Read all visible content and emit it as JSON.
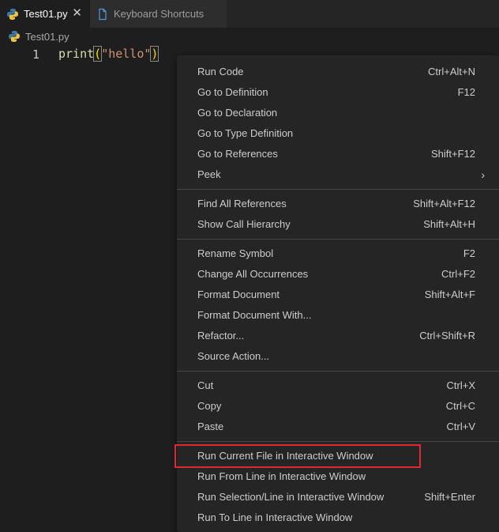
{
  "tabs": [
    {
      "label": "Test01.py",
      "active": true,
      "icon": "python-icon",
      "close": "✕"
    },
    {
      "label": "Keyboard Shortcuts",
      "active": false,
      "icon": "document-icon"
    }
  ],
  "breadcrumb": {
    "file": "Test01.py",
    "icon": "python-icon"
  },
  "editor": {
    "line_number": "1",
    "code": {
      "fn": "print",
      "open": "(",
      "str": "\"hello\"",
      "close": ")"
    }
  },
  "context_menu": {
    "groups": [
      [
        {
          "label": "Run Code",
          "shortcut": "Ctrl+Alt+N"
        },
        {
          "label": "Go to Definition",
          "shortcut": "F12"
        },
        {
          "label": "Go to Declaration",
          "shortcut": ""
        },
        {
          "label": "Go to Type Definition",
          "shortcut": ""
        },
        {
          "label": "Go to References",
          "shortcut": "Shift+F12"
        },
        {
          "label": "Peek",
          "shortcut": "",
          "submenu": true
        }
      ],
      [
        {
          "label": "Find All References",
          "shortcut": "Shift+Alt+F12"
        },
        {
          "label": "Show Call Hierarchy",
          "shortcut": "Shift+Alt+H"
        }
      ],
      [
        {
          "label": "Rename Symbol",
          "shortcut": "F2"
        },
        {
          "label": "Change All Occurrences",
          "shortcut": "Ctrl+F2"
        },
        {
          "label": "Format Document",
          "shortcut": "Shift+Alt+F"
        },
        {
          "label": "Format Document With...",
          "shortcut": ""
        },
        {
          "label": "Refactor...",
          "shortcut": "Ctrl+Shift+R"
        },
        {
          "label": "Source Action...",
          "shortcut": ""
        }
      ],
      [
        {
          "label": "Cut",
          "shortcut": "Ctrl+X"
        },
        {
          "label": "Copy",
          "shortcut": "Ctrl+C"
        },
        {
          "label": "Paste",
          "shortcut": "Ctrl+V"
        }
      ],
      [
        {
          "label": "Run Current File in Interactive Window",
          "shortcut": "",
          "highlighted": true
        },
        {
          "label": "Run From Line in Interactive Window",
          "shortcut": ""
        },
        {
          "label": "Run Selection/Line in Interactive Window",
          "shortcut": "Shift+Enter"
        },
        {
          "label": "Run To Line in Interactive Window",
          "shortcut": ""
        }
      ]
    ]
  },
  "colors": {
    "background": "#1e1e1e",
    "menu_background": "#252526",
    "highlight_border": "#e0282e",
    "function": "#dcdcaa",
    "string": "#ce9178",
    "bracket": "#ffd700"
  }
}
